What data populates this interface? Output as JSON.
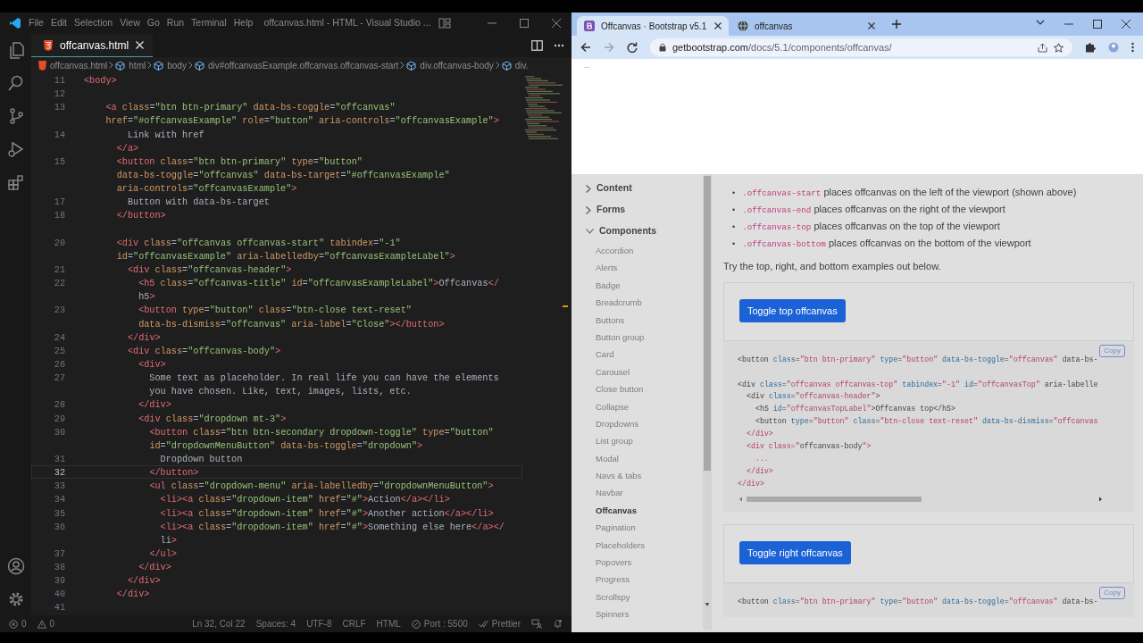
{
  "editor": {
    "menu": [
      "File",
      "Edit",
      "Selection",
      "View",
      "Go",
      "Run",
      "Terminal",
      "Help"
    ],
    "title": "offcanvas.html - HTML - Visual Studio ...",
    "tab": {
      "label": "offcanvas.html"
    },
    "breadcrumb": [
      "offcanvas.html",
      "html",
      "body",
      "div#offcanvasExample.offcanvas.offcanvas-start",
      "div.offcanvas-body",
      "div."
    ],
    "rows": [
      {
        "number": "11",
        "text": "<body>",
        "current": false
      },
      {
        "number": "12",
        "current": false
      },
      {
        "number": "13",
        "text": "    <a class=\"btn btn-primary\" data-bs-toggle=\"offcanvas\"",
        "current": false
      },
      {
        "text": "    href=\"#offcanvasExample\" role=\"button\" aria-controls=\"offcanvasExample\">",
        "current": false
      },
      {
        "number": "14",
        "text": "        Link with href",
        "current": false
      },
      {
        "text": "      </a>",
        "current": false
      },
      {
        "number": "15",
        "text": "      <button class=\"btn btn-primary\" type=\"button\"",
        "current": false
      },
      {
        "text": "      data-bs-toggle=\"offcanvas\" data-bs-target=\"#offcanvasExample\"",
        "current": false
      },
      {
        "text": "      aria-controls=\"offcanvasExample\">",
        "current": false
      },
      {
        "number": "17",
        "text": "        Button with data-bs-target",
        "current": false
      },
      {
        "number": "18",
        "text": "      </button>",
        "current": false
      },
      {
        "current": false
      },
      {
        "number": "20",
        "text": "      <div class=\"offcanvas offcanvas-start\" tabindex=\"-1\"",
        "current": false
      },
      {
        "text": "      id=\"offcanvasExample\" aria-labelledby=\"offcanvasExampleLabel\">",
        "current": false
      },
      {
        "number": "21",
        "text": "        <div class=\"offcanvas-header\">",
        "current": false
      },
      {
        "number": "22",
        "text": "          <h5 class=\"offcanvas-title\" id=\"offcanvasExampleLabel\">Offcanvas</",
        "current": false
      },
      {
        "text": "          h5>",
        "current": false
      },
      {
        "number": "23",
        "text": "          <button type=\"button\" class=\"btn-close text-reset\"",
        "current": false
      },
      {
        "text": "          data-bs-dismiss=\"offcanvas\" aria-label=\"Close\"></button>",
        "current": false
      },
      {
        "number": "24",
        "text": "        </div>",
        "current": false
      },
      {
        "number": "25",
        "text": "        <div class=\"offcanvas-body\">",
        "current": false
      },
      {
        "number": "26",
        "text": "          <div>",
        "current": false
      },
      {
        "number": "27",
        "text": "            Some text as placeholder. In real life you can have the elements",
        "current": false
      },
      {
        "text": "            you have chosen. Like, text, images, lists, etc.",
        "current": false
      },
      {
        "number": "28",
        "text": "          </div>",
        "current": false
      },
      {
        "number": "29",
        "text": "          <div class=\"dropdown mt-3\">",
        "current": false
      },
      {
        "number": "30",
        "text": "            <button class=\"btn btn-secondary dropdown-toggle\" type=\"button\"",
        "current": false
      },
      {
        "text": "            id=\"dropdownMenuButton\" data-bs-toggle=\"dropdown\">",
        "current": false
      },
      {
        "number": "31",
        "text": "              Dropdown button",
        "current": false
      },
      {
        "number": "32",
        "text": "            </button>",
        "current": true
      },
      {
        "number": "33",
        "text": "            <ul class=\"dropdown-menu\" aria-labelledby=\"dropdownMenuButton\">",
        "current": false
      },
      {
        "number": "34",
        "text": "              <li><a class=\"dropdown-item\" href=\"#\">Action</a></li>",
        "current": false
      },
      {
        "number": "35",
        "text": "              <li><a class=\"dropdown-item\" href=\"#\">Another action</a></li>",
        "current": false
      },
      {
        "number": "36",
        "text": "              <li><a class=\"dropdown-item\" href=\"#\">Something else here</a></",
        "current": false
      },
      {
        "text": "              li>",
        "current": false
      },
      {
        "number": "37",
        "text": "            </ul>",
        "current": false
      },
      {
        "number": "38",
        "text": "          </div>",
        "current": false
      },
      {
        "number": "39",
        "text": "        </div>",
        "current": false
      },
      {
        "number": "40",
        "text": "      </div>",
        "current": false
      },
      {
        "number": "41",
        "current": false
      }
    ],
    "status_left": [
      {
        "kind": "error",
        "count": "0"
      },
      {
        "kind": "warning",
        "count": "0"
      }
    ],
    "status_right": [
      {
        "kind": "text",
        "label": "Ln 32, Col 22"
      },
      {
        "kind": "text",
        "label": "Spaces: 4"
      },
      {
        "kind": "text",
        "label": "UTF-8"
      },
      {
        "kind": "text",
        "label": "CRLF"
      },
      {
        "kind": "text",
        "label": "HTML"
      },
      {
        "kind": "port",
        "label": "Port : 5500"
      },
      {
        "kind": "prettier",
        "label": "Prettier"
      }
    ]
  },
  "browser": {
    "tabs": [
      {
        "label": "Offcanvas · Bootstrap v5.1",
        "selected": true
      },
      {
        "label": "offcanvas",
        "selected": false
      }
    ],
    "forward_disabled": true,
    "url": {
      "host": "getbootstrap.com",
      "path": "/docs/5.1/components/offcanvas/"
    },
    "offcanvas": {
      "open": true,
      "body": "..."
    },
    "sidebar": [
      {
        "label": "Content",
        "expanded": false
      },
      {
        "label": "Forms",
        "expanded": false
      },
      {
        "label": "Components",
        "expanded": true,
        "children": [
          {
            "label": "Accordion",
            "selected": false
          },
          {
            "label": "Alerts",
            "selected": false
          },
          {
            "label": "Badge",
            "selected": false
          },
          {
            "label": "Breadcrumb",
            "selected": false
          },
          {
            "label": "Buttons",
            "selected": false
          },
          {
            "label": "Button group",
            "selected": false
          },
          {
            "label": "Card",
            "selected": false
          },
          {
            "label": "Carousel",
            "selected": false
          },
          {
            "label": "Close button",
            "selected": false
          },
          {
            "label": "Collapse",
            "selected": false
          },
          {
            "label": "Dropdowns",
            "selected": false
          },
          {
            "label": "List group",
            "selected": false
          },
          {
            "label": "Modal",
            "selected": false
          },
          {
            "label": "Navs & tabs",
            "selected": false
          },
          {
            "label": "Navbar",
            "selected": false
          },
          {
            "label": "Offcanvas",
            "selected": true
          },
          {
            "label": "Pagination",
            "selected": false
          },
          {
            "label": "Placeholders",
            "selected": false
          },
          {
            "label": "Popovers",
            "selected": false
          },
          {
            "label": "Progress",
            "selected": false
          },
          {
            "label": "Scrollspy",
            "selected": false
          },
          {
            "label": "Spinners",
            "selected": false
          }
        ]
      }
    ],
    "bullets": [
      {
        "marker": "•",
        "code": ".offcanvas-start",
        "text": "places offcanvas on the left of the viewport (shown above)"
      },
      {
        "marker": "•",
        "code": ".offcanvas-end",
        "text": "places offcanvas on the right of the viewport"
      },
      {
        "marker": "•",
        "code": ".offcanvas-top",
        "text": "places offcanvas on the top of the viewport"
      },
      {
        "marker": "•",
        "code": ".offcanvas-bottom",
        "text": "places offcanvas on the bottom of the viewport"
      }
    ],
    "intro": "Try the top, right, and bottom examples out below.",
    "examples": [
      {
        "button": "Toggle top offcanvas",
        "copy": "Copy",
        "code": "<button class=\"btn btn-primary\" type=\"button\" data-bs-toggle=\"offcanvas\" data-bs-\n\n<div class=\"offcanvas offcanvas-top\" tabindex=\"-1\" id=\"offcanvasTop\" aria-labelle\n  <div class=\"offcanvas-header\">\n    <h5 id=\"offcanvasTopLabel\">Offcanvas top</h5>\n    <button type=\"button\" class=\"btn-close text-reset\" data-bs-dismiss=\"offcanvas\n  </div>\n  <div class=\"offcanvas-body\">\n    ...\n  </div>\n</div>",
        "scroll": true
      },
      {
        "button": "Toggle right offcanvas",
        "copy": "Copy",
        "code": "<button class=\"btn btn-primary\" type=\"button\" data-bs-toggle=\"offcanvas\" data-bs-",
        "scroll": false
      }
    ]
  }
}
